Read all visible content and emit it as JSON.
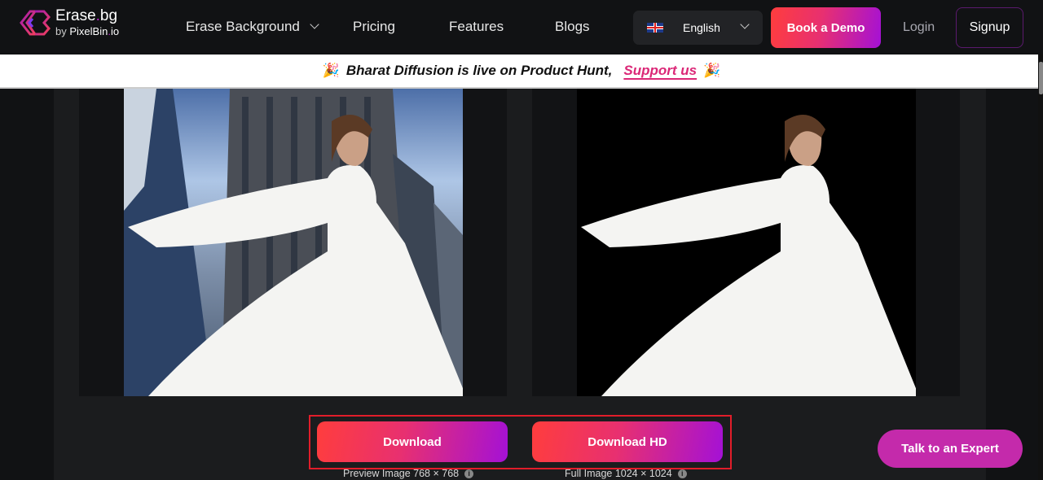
{
  "header": {
    "logo": {
      "title": "Erase",
      "title_dot": ".",
      "title_suffix": "bg",
      "sub_prefix": "by ",
      "sub_brand": "PixelBin",
      "sub_dot": ".",
      "sub_suffix": "io"
    },
    "nav": [
      {
        "label": "Erase Background",
        "has_dropdown": true
      },
      {
        "label": "Pricing"
      },
      {
        "label": "Features"
      },
      {
        "label": "Blogs"
      }
    ],
    "language": {
      "icon": "uk-flag-icon",
      "selected": "English"
    },
    "book_demo_label": "Book a Demo",
    "login_label": "Login",
    "signup_label": "Signup"
  },
  "banner": {
    "icon": "party-popper-icon",
    "text": "Bharat Diffusion is live on Product Hunt,",
    "link_label": "Support us"
  },
  "main": {
    "original_image_alt": "Woman in white flowing dress in front of skyscrapers",
    "result_image_alt": "Woman in white flowing dress with background removed",
    "downloads": [
      {
        "label": "Download",
        "caption": "Preview Image 768 × 768",
        "info_icon": "i"
      },
      {
        "label": "Download HD",
        "caption": "Full Image 1024 × 1024",
        "info_icon": "i"
      }
    ]
  },
  "expert_label": "Talk to an Expert",
  "colors": {
    "accent_start": "#ff3d3d",
    "accent_end": "#a411d6",
    "expert": "#c42aab",
    "highlight_frame": "#e11d2a",
    "link": "#db2777"
  }
}
